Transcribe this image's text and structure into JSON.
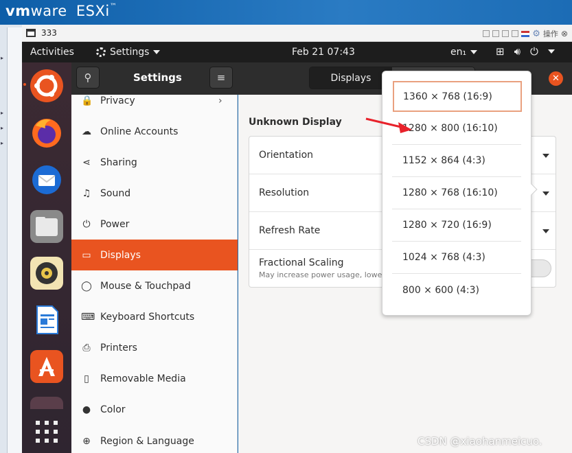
{
  "host": {
    "logo_vm": "vm",
    "logo_ware": "ware",
    "logo_product": "ESXi",
    "logo_reg": "™"
  },
  "console": {
    "title": "333",
    "tools_label": "操作"
  },
  "topbar": {
    "activities": "Activities",
    "app_menu": "Settings",
    "clock": "Feb 21  07:43",
    "lang": "en₁"
  },
  "dock": {
    "items": [
      "ubuntu-software-updater",
      "firefox",
      "thunderbird",
      "files",
      "rhythmbox",
      "libreoffice-writer",
      "ubuntu-software",
      "ubuntu-dock-dot",
      "show-apps"
    ]
  },
  "settings": {
    "title": "Settings",
    "tab_active": "Displays",
    "sidebar": [
      {
        "label": "Privacy",
        "icon": "lock-icon",
        "glyph": "🔒"
      },
      {
        "label": "Online Accounts",
        "icon": "cloud-icon",
        "glyph": "☁"
      },
      {
        "label": "Sharing",
        "icon": "share-icon",
        "glyph": "⋖"
      },
      {
        "label": "Sound",
        "icon": "music-note-icon",
        "glyph": "♫"
      },
      {
        "label": "Power",
        "icon": "power-icon",
        "glyph": "⏻"
      },
      {
        "label": "Displays",
        "icon": "monitor-icon",
        "glyph": "▭"
      },
      {
        "label": "Mouse & Touchpad",
        "icon": "mouse-icon",
        "glyph": "◯"
      },
      {
        "label": "Keyboard Shortcuts",
        "icon": "keyboard-icon",
        "glyph": "⌨"
      },
      {
        "label": "Printers",
        "icon": "printer-icon",
        "glyph": "⎙"
      },
      {
        "label": "Removable Media",
        "icon": "usb-icon",
        "glyph": "▯"
      },
      {
        "label": "Color",
        "icon": "color-icon",
        "glyph": "●"
      },
      {
        "label": "Region & Language",
        "icon": "globe-icon",
        "glyph": "⊕"
      }
    ],
    "display_name": "Unknown Display",
    "rows": {
      "orientation": "Orientation",
      "resolution": "Resolution",
      "refresh_rate": "Refresh Rate",
      "fractional_scaling": "Fractional Scaling",
      "fractional_scaling_hint": "May increase power usage, lower"
    }
  },
  "resolution_menu": {
    "selected": "1360 × 768 (16:9)",
    "options": [
      "1360 × 768 (16:9)",
      "1280 × 800 (16:10)",
      "1152 × 864 (4:3)",
      "1280 × 768 (16:10)",
      "1280 × 720 (16:9)",
      "1024 × 768 (4:3)",
      "800 × 600 (4:3)"
    ]
  },
  "colors": {
    "ubuntu_orange": "#e95420",
    "annotation_red": "#e8222b",
    "selected_outline": "#e9a07e"
  },
  "watermark": "CSDN @xiaohanmeicuo."
}
